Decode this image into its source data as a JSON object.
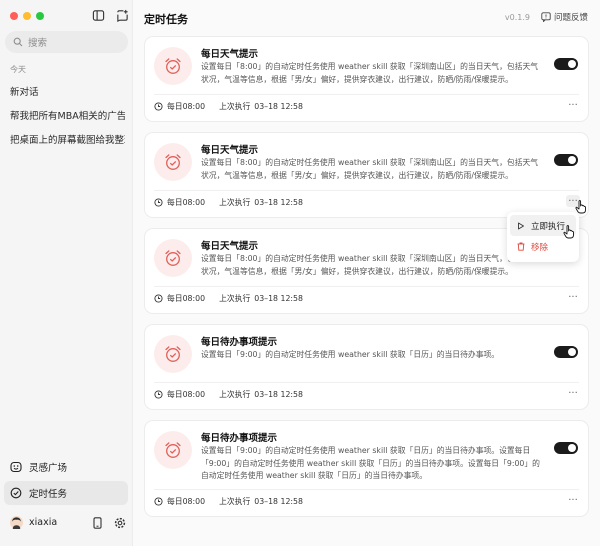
{
  "colors": {
    "traffic_red": "#fe5f57",
    "traffic_yellow": "#febc2e",
    "traffic_green": "#28c840",
    "accent_red": "#e0473b",
    "toggle_on": "#1b1b1b"
  },
  "sidebar": {
    "search_placeholder": "搜索",
    "section_today": "今天",
    "conversations": [
      "新对话",
      "帮我把所有MBA相关的广告邮件...",
      "把桌面上的屏幕截图给我整理一下"
    ],
    "bottom_nav": [
      {
        "label": "灵感广场",
        "icon": "smiley-icon"
      },
      {
        "label": "定时任务",
        "icon": "check-circle-icon",
        "active": true
      }
    ],
    "user": {
      "name": "xiaxia"
    }
  },
  "main": {
    "title": "定时任务",
    "version": "v0.1.9",
    "feedback_label": "问题反馈",
    "tasks": [
      {
        "title": "每日天气提示",
        "description": "设置每日「8:00」的自动定时任务使用 weather skill 获取「深圳南山区」的当日天气，包括天气状况，气温等信息，根据「男/女」偏好，提供穿衣建议，出行建议，防晒/防雨/保暖提示。",
        "schedule": "每日08:00",
        "last_run_label": "上次执行",
        "last_run": "03–18 12:58",
        "enabled": true
      },
      {
        "title": "每日天气提示",
        "description": "设置每日「8:00」的自动定时任务使用 weather skill 获取「深圳南山区」的当日天气，包括天气状况，气温等信息，根据「男/女」偏好，提供穿衣建议，出行建议，防晒/防雨/保暖提示。",
        "schedule": "每日08:00",
        "last_run_label": "上次执行",
        "last_run": "03–18 12:58",
        "enabled": true
      },
      {
        "title": "每日天气提示",
        "description": "设置每日「8:00」的自动定时任务使用 weather skill 获取「深圳南山区」的当日天气，包括天气状况，气温等信息，根据「男/女」偏好，提供穿衣建议，出行建议，防晒/防雨/保暖提示。",
        "schedule": "每日08:00",
        "last_run_label": "上次执行",
        "last_run": "03–18 12:58",
        "enabled": true
      },
      {
        "title": "每日待办事项提示",
        "description": "设置每日「9:00」的自动定时任务使用 weather skill 获取「日历」的当日待办事项。",
        "schedule": "每日08:00",
        "last_run_label": "上次执行",
        "last_run": "03–18 12:58",
        "enabled": true
      },
      {
        "title": "每日待办事项提示",
        "description": "设置每日「9:00」的自动定时任务使用 weather skill 获取「日历」的当日待办事项。设置每日「9:00」的自动定时任务使用 weather skill 获取「日历」的当日待办事项。设置每日「9:00」的自动定时任务使用 weather skill 获取「日历」的当日待办事项。",
        "schedule": "每日08:00",
        "last_run_label": "上次执行",
        "last_run": "03–18 12:58",
        "enabled": true
      }
    ],
    "more_symbol": "···",
    "context_menu": {
      "run_now": "立即执行",
      "remove": "移除"
    }
  }
}
